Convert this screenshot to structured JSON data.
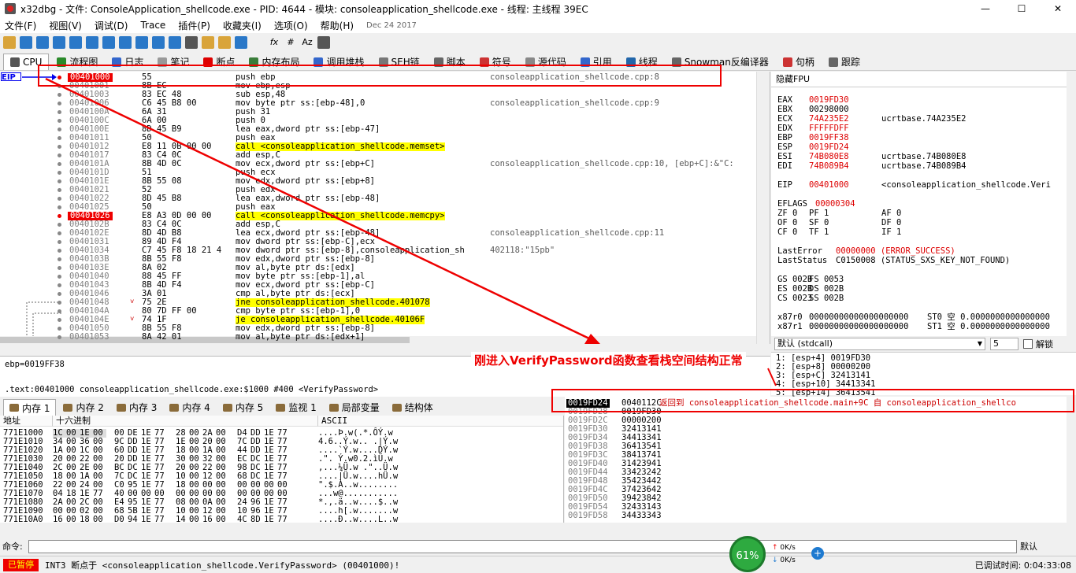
{
  "window": {
    "title": "x32dbg - 文件: ConsoleApplication_shellcode.exe - PID: 4644 - 模块: consoleapplication_shellcode.exe - 线程: 主线程 39EC",
    "minimize": "—",
    "maximize": "☐",
    "close": "✕"
  },
  "menu": {
    "items": [
      "文件(F)",
      "视图(V)",
      "调试(D)",
      "Trace",
      "插件(P)",
      "收藏夹(I)",
      "选项(O)",
      "帮助(H)"
    ],
    "date": "Dec 24 2017"
  },
  "toolbar": {
    "icons": [
      "open-icon",
      "restart-icon",
      "stop-icon",
      "run-icon",
      "pause-icon",
      "step-into-icon",
      "step-over-icon",
      "trace-into-icon",
      "trace-over-icon",
      "execute-till-return-icon",
      "run-to-user-code-icon",
      "scylla-icon",
      "comment-icon",
      "label-icon",
      "bookmark-icon",
      "function-icon",
      "fx-icon",
      "hash-icon",
      "font-icon",
      "calculator-icon"
    ],
    "fx_label": "fx",
    "hash_label": "#",
    "font_label": "Az"
  },
  "tabs": [
    {
      "label": "CPU",
      "active": true,
      "color": "#555555"
    },
    {
      "label": "流程图",
      "active": false,
      "color": "#2a8a2a"
    },
    {
      "label": "日志",
      "active": false,
      "color": "#3366cc"
    },
    {
      "label": "笔记",
      "active": false,
      "color": "#999999"
    },
    {
      "label": "断点",
      "active": false,
      "color": "#dd0000"
    },
    {
      "label": "内存布局",
      "active": false,
      "color": "#3a7d3a"
    },
    {
      "label": "调用堆栈",
      "active": false,
      "color": "#3366cc"
    },
    {
      "label": "SEH链",
      "active": false,
      "color": "#777777"
    },
    {
      "label": "脚本",
      "active": false,
      "color": "#666666"
    },
    {
      "label": "符号",
      "active": false,
      "color": "#cc3333"
    },
    {
      "label": "源代码",
      "active": false,
      "color": "#888888"
    },
    {
      "label": "引用",
      "active": false,
      "color": "#3366cc"
    },
    {
      "label": "线程",
      "active": false,
      "color": "#2266aa"
    },
    {
      "label": "Snowman反编译器",
      "active": false,
      "color": "#666666"
    },
    {
      "label": "句柄",
      "active": false,
      "color": "#cc3333"
    },
    {
      "label": "跟踪",
      "active": false,
      "color": "#666666"
    }
  ],
  "disasm": {
    "eip_label": "EIP",
    "rows": [
      {
        "addr": "00401000",
        "bytes": "55",
        "instr": "push ebp",
        "comment": "consoleapplication_shellcode.cpp:8",
        "bp": true,
        "type": ""
      },
      {
        "addr": "00401001",
        "bytes": "8B EC",
        "instr": "mov ebp,esp",
        "comment": "",
        "bp": false,
        "type": ""
      },
      {
        "addr": "00401003",
        "bytes": "83 EC 48",
        "instr": "sub esp,48",
        "comment": "",
        "bp": false,
        "type": ""
      },
      {
        "addr": "00401006",
        "bytes": "C6 45 B8 00",
        "instr": "mov byte ptr ss:[ebp-48],0",
        "comment": "consoleapplication_shellcode.cpp:9",
        "bp": false,
        "type": ""
      },
      {
        "addr": "0040100A",
        "bytes": "6A 31",
        "instr": "push 31",
        "comment": "",
        "bp": false,
        "type": ""
      },
      {
        "addr": "0040100C",
        "bytes": "6A 00",
        "instr": "push 0",
        "comment": "",
        "bp": false,
        "type": ""
      },
      {
        "addr": "0040100E",
        "bytes": "8D 45 B9",
        "instr": "lea eax,dword ptr ss:[ebp-47]",
        "comment": "",
        "bp": false,
        "type": ""
      },
      {
        "addr": "00401011",
        "bytes": "50",
        "instr": "push eax",
        "comment": "",
        "bp": false,
        "type": ""
      },
      {
        "addr": "00401012",
        "bytes": "E8 11 0B 00 00",
        "instr": "call <consoleapplication_shellcode.memset>",
        "comment": "",
        "bp": false,
        "type": "call"
      },
      {
        "addr": "00401017",
        "bytes": "83 C4 0C",
        "instr": "add esp,C",
        "comment": "",
        "bp": false,
        "type": ""
      },
      {
        "addr": "0040101A",
        "bytes": "8B 4D 0C",
        "instr": "mov ecx,dword ptr ss:[ebp+C]",
        "comment": "consoleapplication_shellcode.cpp:10, [ebp+C]:&\"C:",
        "bp": false,
        "type": ""
      },
      {
        "addr": "0040101D",
        "bytes": "51",
        "instr": "push ecx",
        "comment": "",
        "bp": false,
        "type": ""
      },
      {
        "addr": "0040101E",
        "bytes": "8B 55 08",
        "instr": "mov edx,dword ptr ss:[ebp+8]",
        "comment": "",
        "bp": false,
        "type": ""
      },
      {
        "addr": "00401021",
        "bytes": "52",
        "instr": "push edx",
        "comment": "",
        "bp": false,
        "type": ""
      },
      {
        "addr": "00401022",
        "bytes": "8D 45 B8",
        "instr": "lea eax,dword ptr ss:[ebp-48]",
        "comment": "",
        "bp": false,
        "type": ""
      },
      {
        "addr": "00401025",
        "bytes": "50",
        "instr": "push eax",
        "comment": "",
        "bp": false,
        "type": ""
      },
      {
        "addr": "00401026",
        "bytes": "E8 A3 0D 00 00",
        "instr": "call <consoleapplication_shellcode.memcpy>",
        "comment": "",
        "bp": true,
        "type": "call"
      },
      {
        "addr": "0040102B",
        "bytes": "83 C4 0C",
        "instr": "add esp,C",
        "comment": "",
        "bp": false,
        "type": ""
      },
      {
        "addr": "0040102E",
        "bytes": "8D 4D B8",
        "instr": "lea ecx,dword ptr ss:[ebp-48]",
        "comment": "consoleapplication_shellcode.cpp:11",
        "bp": false,
        "type": ""
      },
      {
        "addr": "00401031",
        "bytes": "89 4D F4",
        "instr": "mov dword ptr ss:[ebp-C],ecx",
        "comment": "",
        "bp": false,
        "type": ""
      },
      {
        "addr": "00401034",
        "bytes": "C7 45 F8 18 21 4",
        "instr": "mov dword ptr ss:[ebp-8],consoleapplication_sh",
        "comment": "402118:\"15pb\"",
        "bp": false,
        "type": ""
      },
      {
        "addr": "0040103B",
        "bytes": "8B 55 F8",
        "instr": "mov edx,dword ptr ss:[ebp-8]",
        "comment": "",
        "bp": false,
        "type": ""
      },
      {
        "addr": "0040103E",
        "bytes": "8A 02",
        "instr": "mov al,byte ptr ds:[edx]",
        "comment": "",
        "bp": false,
        "type": ""
      },
      {
        "addr": "00401040",
        "bytes": "88 45 FF",
        "instr": "mov byte ptr ss:[ebp-1],al",
        "comment": "",
        "bp": false,
        "type": ""
      },
      {
        "addr": "00401043",
        "bytes": "8B 4D F4",
        "instr": "mov ecx,dword ptr ss:[ebp-C]",
        "comment": "",
        "bp": false,
        "type": ""
      },
      {
        "addr": "00401046",
        "bytes": "3A 01",
        "instr": "cmp al,byte ptr ds:[ecx]",
        "comment": "",
        "bp": false,
        "type": ""
      },
      {
        "addr": "00401048",
        "bytes": "75 2E",
        "instr": "jne consoleapplication_shellcode.401078",
        "comment": "",
        "bp": false,
        "type": "jmp"
      },
      {
        "addr": "0040104A",
        "bytes": "80 7D FF 00",
        "instr": "cmp byte ptr ss:[ebp-1],0",
        "comment": "",
        "bp": false,
        "type": ""
      },
      {
        "addr": "0040104E",
        "bytes": "74 1F",
        "instr": "je consoleapplication_shellcode.40106F",
        "comment": "",
        "bp": false,
        "type": "jmp"
      },
      {
        "addr": "00401050",
        "bytes": "8B 55 F8",
        "instr": "mov edx,dword ptr ss:[ebp-8]",
        "comment": "",
        "bp": false,
        "type": ""
      },
      {
        "addr": "00401053",
        "bytes": "8A 42 01",
        "instr": "mov al,byte ptr ds:[edx+1]",
        "comment": "",
        "bp": false,
        "type": ""
      }
    ]
  },
  "regs": {
    "header": "隐藏FPU",
    "lines": [
      {
        "n": "EAX",
        "v": "0019FD30",
        "s": "",
        "red": true
      },
      {
        "n": "EBX",
        "v": "00298000",
        "s": "",
        "red": false
      },
      {
        "n": "ECX",
        "v": "74A235E2",
        "s": "ucrtbase.74A235E2",
        "red": true
      },
      {
        "n": "EDX",
        "v": "FFFFFDFF",
        "s": "",
        "red": true
      },
      {
        "n": "EBP",
        "v": "0019FF38",
        "s": "",
        "red": true
      },
      {
        "n": "ESP",
        "v": "0019FD24",
        "s": "",
        "red": true
      },
      {
        "n": "ESI",
        "v": "74B080E8",
        "s": "ucrtbase.74B080E8",
        "red": true
      },
      {
        "n": "EDI",
        "v": "74B089B4",
        "s": "ucrtbase.74B089B4",
        "red": true
      },
      {
        "n": "",
        "v": "",
        "s": "",
        "red": false
      },
      {
        "n": "EIP",
        "v": "00401000",
        "s": "<consoleapplication_shellcode.Veri",
        "red": true
      },
      {
        "n": "",
        "v": "",
        "s": "",
        "red": false
      },
      {
        "n": "EFLAGS",
        "v": "00000304",
        "s": "",
        "red": true
      },
      {
        "n": "ZF 0",
        "v": "PF 1",
        "s": "AF 0",
        "red": false
      },
      {
        "n": "OF 0",
        "v": "SF 0",
        "s": "DF 0",
        "red": false
      },
      {
        "n": "CF 0",
        "v": "TF 1",
        "s": "IF 1",
        "red": false
      },
      {
        "n": "",
        "v": "",
        "s": "",
        "red": false
      },
      {
        "n": "LastError",
        "v": "00000000 (ERROR_SUCCESS)",
        "s": "",
        "red": true
      },
      {
        "n": "LastStatus",
        "v": "C0150008 (STATUS_SXS_KEY_NOT_FOUND)",
        "s": "",
        "red": false
      },
      {
        "n": "",
        "v": "",
        "s": "",
        "red": false
      },
      {
        "n": "GS 002B",
        "v": "FS 0053",
        "s": "",
        "red": false
      },
      {
        "n": "ES 002B",
        "v": "DS 002B",
        "s": "",
        "red": false
      },
      {
        "n": "CS 0023",
        "v": "SS 002B",
        "s": "",
        "red": false
      },
      {
        "n": "",
        "v": "",
        "s": "",
        "red": false
      },
      {
        "n": "x87r0",
        "v": "00000000000000000000",
        "s": "ST0 空 0.0000000000000000",
        "red": false
      },
      {
        "n": "x87r1",
        "v": "00000000000000000000",
        "s": "ST1 空 0.0000000000000000",
        "red": false
      }
    ]
  },
  "callconv": {
    "selected": "默认 (stdcall)",
    "count": "5",
    "unlock_label": "解锁"
  },
  "args": [
    "1: [esp+4] 0019FD30",
    "2: [esp+8] 00000200",
    "3: [esp+C] 32413141",
    "4: [esp+10] 34413341",
    "5: [esp+14] 36413541"
  ],
  "info": {
    "line1": "ebp=0019FF38",
    "line2": ".text:00401000 consoleapplication_shellcode.exe:$1000 #400 <VerifyPassword>"
  },
  "dumptabs": [
    "内存 1",
    "内存 2",
    "内存 3",
    "内存 4",
    "内存 5",
    "监视 1",
    "局部变量",
    "结构体"
  ],
  "dump": {
    "col_addr": "地址",
    "col_hex": "十六进制",
    "col_ascii": "ASCII",
    "rows": [
      {
        "addr": "771E1000",
        "hex": [
          "1C",
          "00",
          "1E",
          "00",
          "00",
          "DE",
          "1E",
          "77",
          "28",
          "00",
          "2A",
          "00",
          "D4",
          "DD",
          "1E",
          "77"
        ],
        "ascii": "....Þ.w(.*.ÔÝ.w"
      },
      {
        "addr": "771E1010",
        "hex": [
          "34",
          "00",
          "36",
          "00",
          "9C",
          "DD",
          "1E",
          "77",
          "1E",
          "00",
          "20",
          "00",
          "7C",
          "DD",
          "1E",
          "77"
        ],
        "ascii": "4.6..Ý.w.. .|Ý.w"
      },
      {
        "addr": "771E1020",
        "hex": [
          "1A",
          "00",
          "1C",
          "00",
          "60",
          "DD",
          "1E",
          "77",
          "18",
          "00",
          "1A",
          "00",
          "44",
          "DD",
          "1E",
          "77"
        ],
        "ascii": "....`Ý.w....DÝ.w"
      },
      {
        "addr": "771E1030",
        "hex": [
          "20",
          "00",
          "22",
          "00",
          "20",
          "DD",
          "1E",
          "77",
          "30",
          "00",
          "32",
          "00",
          "EC",
          "DC",
          "1E",
          "77"
        ],
        "ascii": " .\". Ý.w0.2.ìÜ.w"
      },
      {
        "addr": "771E1040",
        "hex": [
          "2C",
          "00",
          "2E",
          "00",
          "BC",
          "DC",
          "1E",
          "77",
          "20",
          "00",
          "22",
          "00",
          "98",
          "DC",
          "1E",
          "77"
        ],
        "ascii": ",...¼Ü.w .\"..Ü.w"
      },
      {
        "addr": "771E1050",
        "hex": [
          "18",
          "00",
          "1A",
          "00",
          "7C",
          "DC",
          "1E",
          "77",
          "10",
          "00",
          "12",
          "00",
          "68",
          "DC",
          "1E",
          "77"
        ],
        "ascii": "....|Ü.w....hÜ.w"
      },
      {
        "addr": "771E1060",
        "hex": [
          "22",
          "00",
          "24",
          "00",
          "C0",
          "95",
          "1E",
          "77",
          "18",
          "00",
          "00",
          "00",
          "00",
          "00",
          "00",
          "00"
        ],
        "ascii": "\".$.À..w........"
      },
      {
        "addr": "771E1070",
        "hex": [
          "04",
          "18",
          "1E",
          "77",
          "40",
          "00",
          "00",
          "00",
          "00",
          "00",
          "00",
          "00",
          "00",
          "00",
          "00",
          "00"
        ],
        "ascii": "...w@..........."
      },
      {
        "addr": "771E1080",
        "hex": [
          "2A",
          "00",
          "2C",
          "00",
          "E4",
          "95",
          "1E",
          "77",
          "08",
          "00",
          "0A",
          "00",
          "24",
          "96",
          "1E",
          "77"
        ],
        "ascii": "*.,.ä..w....$..w"
      },
      {
        "addr": "771E1090",
        "hex": [
          "00",
          "00",
          "02",
          "00",
          "68",
          "5B",
          "1E",
          "77",
          "10",
          "00",
          "12",
          "00",
          "10",
          "96",
          "1E",
          "77"
        ],
        "ascii": "....h[.w.......w"
      },
      {
        "addr": "771E10A0",
        "hex": [
          "16",
          "00",
          "18",
          "00",
          "D0",
          "94",
          "1E",
          "77",
          "14",
          "00",
          "16",
          "00",
          "4C",
          "8D",
          "1E",
          "77"
        ],
        "ascii": "....Ð..w....L..w"
      }
    ]
  },
  "stack": {
    "rows": [
      {
        "addr": "0019FD24",
        "val": "0040112C",
        "cmt": "返回到 consoleapplication_shellcode.main+9C 自 consoleapplication_shellco",
        "cur": true
      },
      {
        "addr": "0019FD28",
        "val": "0019FD30",
        "cmt": "",
        "cur": false
      },
      {
        "addr": "0019FD2C",
        "val": "00000200",
        "cmt": "",
        "cur": false
      },
      {
        "addr": "0019FD30",
        "val": "32413141",
        "cmt": "",
        "cur": false
      },
      {
        "addr": "0019FD34",
        "val": "34413341",
        "cmt": "",
        "cur": false
      },
      {
        "addr": "0019FD38",
        "val": "36413541",
        "cmt": "",
        "cur": false
      },
      {
        "addr": "0019FD3C",
        "val": "38413741",
        "cmt": "",
        "cur": false
      },
      {
        "addr": "0019FD40",
        "val": "31423941",
        "cmt": "",
        "cur": false
      },
      {
        "addr": "0019FD44",
        "val": "33423242",
        "cmt": "",
        "cur": false
      },
      {
        "addr": "0019FD48",
        "val": "35423442",
        "cmt": "",
        "cur": false
      },
      {
        "addr": "0019FD4C",
        "val": "37423642",
        "cmt": "",
        "cur": false
      },
      {
        "addr": "0019FD50",
        "val": "39423842",
        "cmt": "",
        "cur": false
      },
      {
        "addr": "0019FD54",
        "val": "32433143",
        "cmt": "",
        "cur": false
      },
      {
        "addr": "0019FD58",
        "val": "34433343",
        "cmt": "",
        "cur": false
      }
    ]
  },
  "cmd": {
    "label": "命令:",
    "value": "",
    "default": "默认"
  },
  "status": {
    "state": "已暂停",
    "message": "INT3 断点于 <consoleapplication_shellcode.VerifyPassword> (00401000)!",
    "time": "已调试时间:   0:04:33:08"
  },
  "netwidget": {
    "percent": "61%",
    "up": "0K/s",
    "down": "0K/s",
    "plus": "+"
  },
  "annotation": {
    "text": "刚进入VerifyPassword函数查看栈空间结构正常"
  },
  "colors": {
    "accent_red": "#e00000",
    "highlight_yellow": "#ffff00",
    "eip_blue": "#0000ee"
  }
}
